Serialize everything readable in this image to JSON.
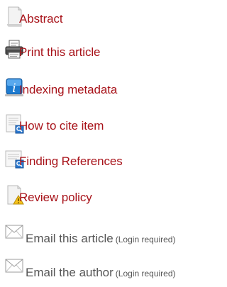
{
  "reading_tools": {
    "items": [
      {
        "label": "Abstract",
        "icon": "document-icon"
      },
      {
        "label": "Print this article",
        "icon": "printer-icon"
      },
      {
        "label": "Indexing metadata",
        "icon": "info-icon"
      },
      {
        "label": "How to cite item",
        "icon": "cite-search-icon"
      },
      {
        "label": "Finding References",
        "icon": "find-references-icon"
      },
      {
        "label": "Review policy",
        "icon": "warning-document-icon"
      }
    ],
    "email_items": [
      {
        "label": "Email this article",
        "note": "(Login required)",
        "icon": "envelope-icon"
      },
      {
        "label": "Email the author",
        "note": "(Login required)",
        "icon": "envelope-icon"
      }
    ],
    "colors": {
      "link": "#a8131a",
      "text": "#555555"
    }
  }
}
